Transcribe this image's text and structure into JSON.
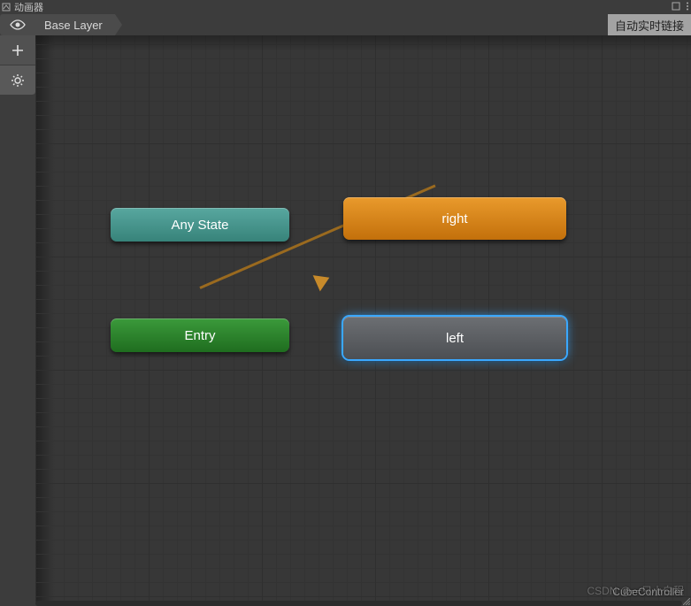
{
  "window": {
    "title": "动画器"
  },
  "breadcrumb": {
    "layer_label": "Base Layer",
    "auto_live_link": "自动实时链接"
  },
  "nodes": {
    "any_state": {
      "label": "Any State"
    },
    "entry": {
      "label": "Entry"
    },
    "right": {
      "label": "right"
    },
    "left": {
      "label": "left"
    }
  },
  "footer": {
    "controller_name": "CubeController",
    "watermark": "CSDN @一只小白程"
  },
  "icons": {
    "title": "animator-icon",
    "visibility": "eye-icon",
    "add": "plus-icon",
    "settings": "gear-icon",
    "maximize": "maximize-icon",
    "menu": "menu-icon"
  },
  "colors": {
    "any_state": "#4e968e",
    "entry": "#2f8430",
    "default_state": "#d8881d",
    "normal_state": "#5d6064",
    "selection": "#3aa8ff",
    "transition": "#9a6a1f"
  }
}
